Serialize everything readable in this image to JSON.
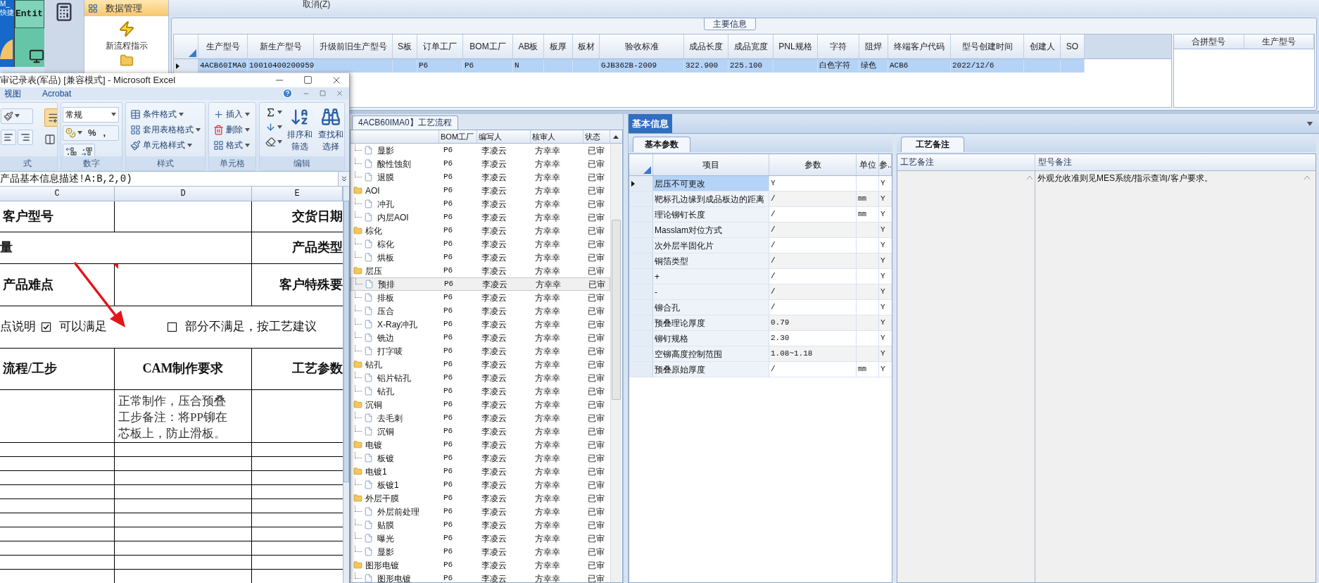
{
  "desktop": {
    "tiles": [
      {
        "kind": "shortcut",
        "lines": [
          "M_",
          "快捷"
        ]
      },
      {
        "kind": "app",
        "lines": [
          "Entit"
        ]
      }
    ]
  },
  "nav": {
    "header": "数据管理",
    "items": [
      {
        "label": "新流程指示"
      }
    ]
  },
  "toolbar": {
    "buttons": [
      "取消(Z)"
    ]
  },
  "main_info": {
    "title": "主要信息",
    "columns": [
      "生产型号",
      "新生产型号",
      "升级前旧生产型号",
      "S板",
      "订单工厂",
      "BOM工厂",
      "AB板",
      "板厚",
      "板材",
      "验收标准",
      "成品长度",
      "成品宽度",
      "PNL规格",
      "字符",
      "阻焊",
      "终端客户代码",
      "型号创建时间",
      "创建人",
      "SO"
    ],
    "rows": [
      {
        "selected": true,
        "cells": [
          "4ACB60IMA0",
          "10010400200959",
          null,
          null,
          "P6",
          "P6",
          "N",
          null,
          null,
          "GJB362B-2009",
          "322.900",
          "225.100",
          null,
          "白色字符",
          "绿色",
          "ACB6",
          "2022/12/6",
          null,
          null
        ]
      }
    ],
    "side_columns": [
      "合拼型号",
      "生产型号"
    ]
  },
  "excel": {
    "title": "审记录表(军品)  [兼容模式] - Microsoft Excel",
    "tabs": [
      "视图",
      "Acrobat"
    ],
    "groups": [
      {
        "kind": "alignment",
        "label": "式"
      },
      {
        "kind": "number",
        "label": "数字",
        "format": "常规",
        "buttons": [
          "%",
          ","
        ]
      },
      {
        "kind": "styles",
        "label": "样式",
        "items": [
          "条件格式",
          "套用表格格式",
          "单元格样式"
        ]
      },
      {
        "kind": "cells",
        "label": "单元格",
        "items": [
          "插入",
          "删除",
          "格式"
        ]
      },
      {
        "kind": "editing",
        "label": "编辑",
        "items": [
          "排序和筛选",
          "查找和选择"
        ]
      }
    ],
    "formula": "产品基本信息描述!A:B,2,0)",
    "columns": [
      "C",
      "D",
      "E"
    ],
    "sheet": [
      {
        "kind": "header",
        "c": "客户型号",
        "e": "交货日期"
      },
      {
        "kind": "merged",
        "c": "量",
        "e": "产品类型"
      },
      {
        "kind": "header",
        "c": "产品难点",
        "e": "客户特殊要",
        "note": true
      },
      {
        "kind": "options",
        "lead": "点说明",
        "options": [
          {
            "label": "可以满足",
            "checked": true
          },
          {
            "label": "部分不满足，按工艺建议",
            "checked": false
          }
        ]
      },
      {
        "kind": "header",
        "c": "流程/工步",
        "d": "CAM制作要求",
        "e": "工艺参数"
      },
      {
        "kind": "body",
        "d": "正常制作，压合预叠工步备注：将PP铆在芯板上，防止滑板。"
      }
    ]
  },
  "process_flow": {
    "tab": "4ACB60IMA0】工艺流程",
    "columns": [
      "BOM工厂",
      "编写人",
      "核审人",
      "状态"
    ],
    "tree": [
      {
        "children": [
          {
            "name": "显影",
            "bom": "P6",
            "writer": "李凌云",
            "reviewer": "方幸幸",
            "status": "已审",
            "selected": false
          },
          {
            "name": "酸性蚀刻",
            "bom": "P6",
            "writer": "李凌云",
            "reviewer": "方幸幸",
            "status": "已审",
            "selected": false
          },
          {
            "name": "退膜",
            "bom": "P6",
            "writer": "李凌云",
            "reviewer": "方幸幸",
            "status": "已审",
            "selected": false
          }
        ]
      },
      {
        "name": "AOI",
        "bom": "P6",
        "writer": "李凌云",
        "reviewer": "方幸幸",
        "status": "已审",
        "selected": false,
        "children": [
          {
            "name": "冲孔",
            "bom": "P6",
            "writer": "李凌云",
            "reviewer": "方幸幸",
            "status": "已审",
            "selected": false
          },
          {
            "name": "内层AOI",
            "bom": "P6",
            "writer": "李凌云",
            "reviewer": "方幸幸",
            "status": "已审",
            "selected": false
          }
        ]
      },
      {
        "name": "棕化",
        "bom": "P6",
        "writer": "李凌云",
        "reviewer": "方幸幸",
        "status": "已审",
        "selected": false,
        "children": [
          {
            "name": "棕化",
            "bom": "P6",
            "writer": "李凌云",
            "reviewer": "方幸幸",
            "status": "已审",
            "selected": false
          },
          {
            "name": "烘板",
            "bom": "P6",
            "writer": "李凌云",
            "reviewer": "方幸幸",
            "status": "已审",
            "selected": false
          }
        ]
      },
      {
        "name": "层压",
        "bom": "P6",
        "writer": "李凌云",
        "reviewer": "方幸幸",
        "status": "已审",
        "selected": false,
        "children": [
          {
            "name": "预排",
            "bom": "P6",
            "writer": "李凌云",
            "reviewer": "方幸幸",
            "status": "已审",
            "selected": true
          },
          {
            "name": "排板",
            "bom": "P6",
            "writer": "李凌云",
            "reviewer": "方幸幸",
            "status": "已审",
            "selected": false
          },
          {
            "name": "压合",
            "bom": "P6",
            "writer": "李凌云",
            "reviewer": "方幸幸",
            "status": "已审",
            "selected": false
          },
          {
            "name": "X-Ray冲孔",
            "bom": "P6",
            "writer": "李凌云",
            "reviewer": "方幸幸",
            "status": "已审",
            "selected": false
          },
          {
            "name": "铣边",
            "bom": "P6",
            "writer": "李凌云",
            "reviewer": "方幸幸",
            "status": "已审",
            "selected": false
          },
          {
            "name": "打字唛",
            "bom": "P6",
            "writer": "李凌云",
            "reviewer": "方幸幸",
            "status": "已审",
            "selected": false
          }
        ]
      },
      {
        "name": "钻孔",
        "bom": "P6",
        "writer": "李凌云",
        "reviewer": "方幸幸",
        "status": "已审",
        "selected": false,
        "children": [
          {
            "name": "铝片钻孔",
            "bom": "P6",
            "writer": "李凌云",
            "reviewer": "方幸幸",
            "status": "已审",
            "selected": false
          },
          {
            "name": "钻孔",
            "bom": "P6",
            "writer": "李凌云",
            "reviewer": "方幸幸",
            "status": "已审",
            "selected": false
          }
        ]
      },
      {
        "name": "沉铜",
        "bom": "P6",
        "writer": "李凌云",
        "reviewer": "方幸幸",
        "status": "已审",
        "selected": false,
        "children": [
          {
            "name": "去毛刺",
            "bom": "P6",
            "writer": "李凌云",
            "reviewer": "方幸幸",
            "status": "已审",
            "selected": false
          },
          {
            "name": "沉铜",
            "bom": "P6",
            "writer": "李凌云",
            "reviewer": "方幸幸",
            "status": "已审",
            "selected": false
          }
        ]
      },
      {
        "name": "电镀",
        "bom": "P6",
        "writer": "李凌云",
        "reviewer": "方幸幸",
        "status": "已审",
        "selected": false,
        "children": [
          {
            "name": "板镀",
            "bom": "P6",
            "writer": "李凌云",
            "reviewer": "方幸幸",
            "status": "已审",
            "selected": false
          }
        ]
      },
      {
        "name": "电镀1",
        "bom": "P6",
        "writer": "李凌云",
        "reviewer": "方幸幸",
        "status": "已审",
        "selected": false,
        "children": [
          {
            "name": "板镀1",
            "bom": "P6",
            "writer": "李凌云",
            "reviewer": "方幸幸",
            "status": "已审",
            "selected": false
          }
        ]
      },
      {
        "name": "外层干膜",
        "bom": "P6",
        "writer": "李凌云",
        "reviewer": "方幸幸",
        "status": "已审",
        "selected": false,
        "children": [
          {
            "name": "外层前处理",
            "bom": "P6",
            "writer": "李凌云",
            "reviewer": "方幸幸",
            "status": "已审",
            "selected": false
          },
          {
            "name": "贴膜",
            "bom": "P6",
            "writer": "李凌云",
            "reviewer": "方幸幸",
            "status": "已审",
            "selected": false
          },
          {
            "name": "曝光",
            "bom": "P6",
            "writer": "李凌云",
            "reviewer": "方幸幸",
            "status": "已审",
            "selected": false
          },
          {
            "name": "显影",
            "bom": "P6",
            "writer": "李凌云",
            "reviewer": "方幸幸",
            "status": "已审",
            "selected": false
          }
        ]
      },
      {
        "name": "图形电镀",
        "bom": "P6",
        "writer": "李凌云",
        "reviewer": "方幸幸",
        "status": "已审",
        "selected": false,
        "children": [
          {
            "name": "图形电镀",
            "bom": "P6",
            "writer": "李凌云",
            "reviewer": "方幸幸",
            "status": "已审",
            "selected": false
          }
        ]
      }
    ]
  },
  "basic_info": {
    "tab": "基本信息",
    "params": {
      "tab": "基本参数",
      "columns": [
        "项目",
        "参数",
        "单位",
        "参.."
      ],
      "rows": [
        {
          "item": "层压不可更改",
          "value": "Y",
          "flag": "Y",
          "selected": true
        },
        {
          "item": "靶标孔边缘到成品板边的距离",
          "value": "/",
          "unit": "mm",
          "flag": "Y",
          "selected": false
        },
        {
          "item": "理论铆钉长度",
          "value": "/",
          "unit": "mm",
          "flag": "Y",
          "selected": false
        },
        {
          "item": "Masslam对位方式",
          "value": "/",
          "flag": "Y",
          "selected": false
        },
        {
          "item": "次外层半固化片",
          "value": "/",
          "flag": "Y",
          "selected": false
        },
        {
          "item": "铜箔类型",
          "value": "/",
          "flag": "Y",
          "selected": false
        },
        {
          "item": "+",
          "value": "/",
          "flag": "Y",
          "selected": false
        },
        {
          "item": "-",
          "value": "/",
          "flag": "Y",
          "selected": false
        },
        {
          "item": "铆合孔",
          "value": "/",
          "flag": "Y",
          "selected": false
        },
        {
          "item": "预叠理论厚度",
          "value": "0.79",
          "flag": "Y",
          "selected": false
        },
        {
          "item": "铆钉规格",
          "value": "2.30",
          "flag": "Y",
          "selected": false
        },
        {
          "item": "空铆高度控制范围",
          "value": "1.08~1.18",
          "flag": "Y",
          "selected": false
        },
        {
          "item": "预叠原始厚度",
          "value": "/",
          "unit": "mm",
          "flag": "Y",
          "selected": false
        }
      ]
    },
    "notes": {
      "tab": "工艺备注",
      "columns": [
        "工艺备注",
        "型号备注"
      ],
      "model_note": "外观允收准则见MES系统/指示查询/客户要求。"
    }
  }
}
